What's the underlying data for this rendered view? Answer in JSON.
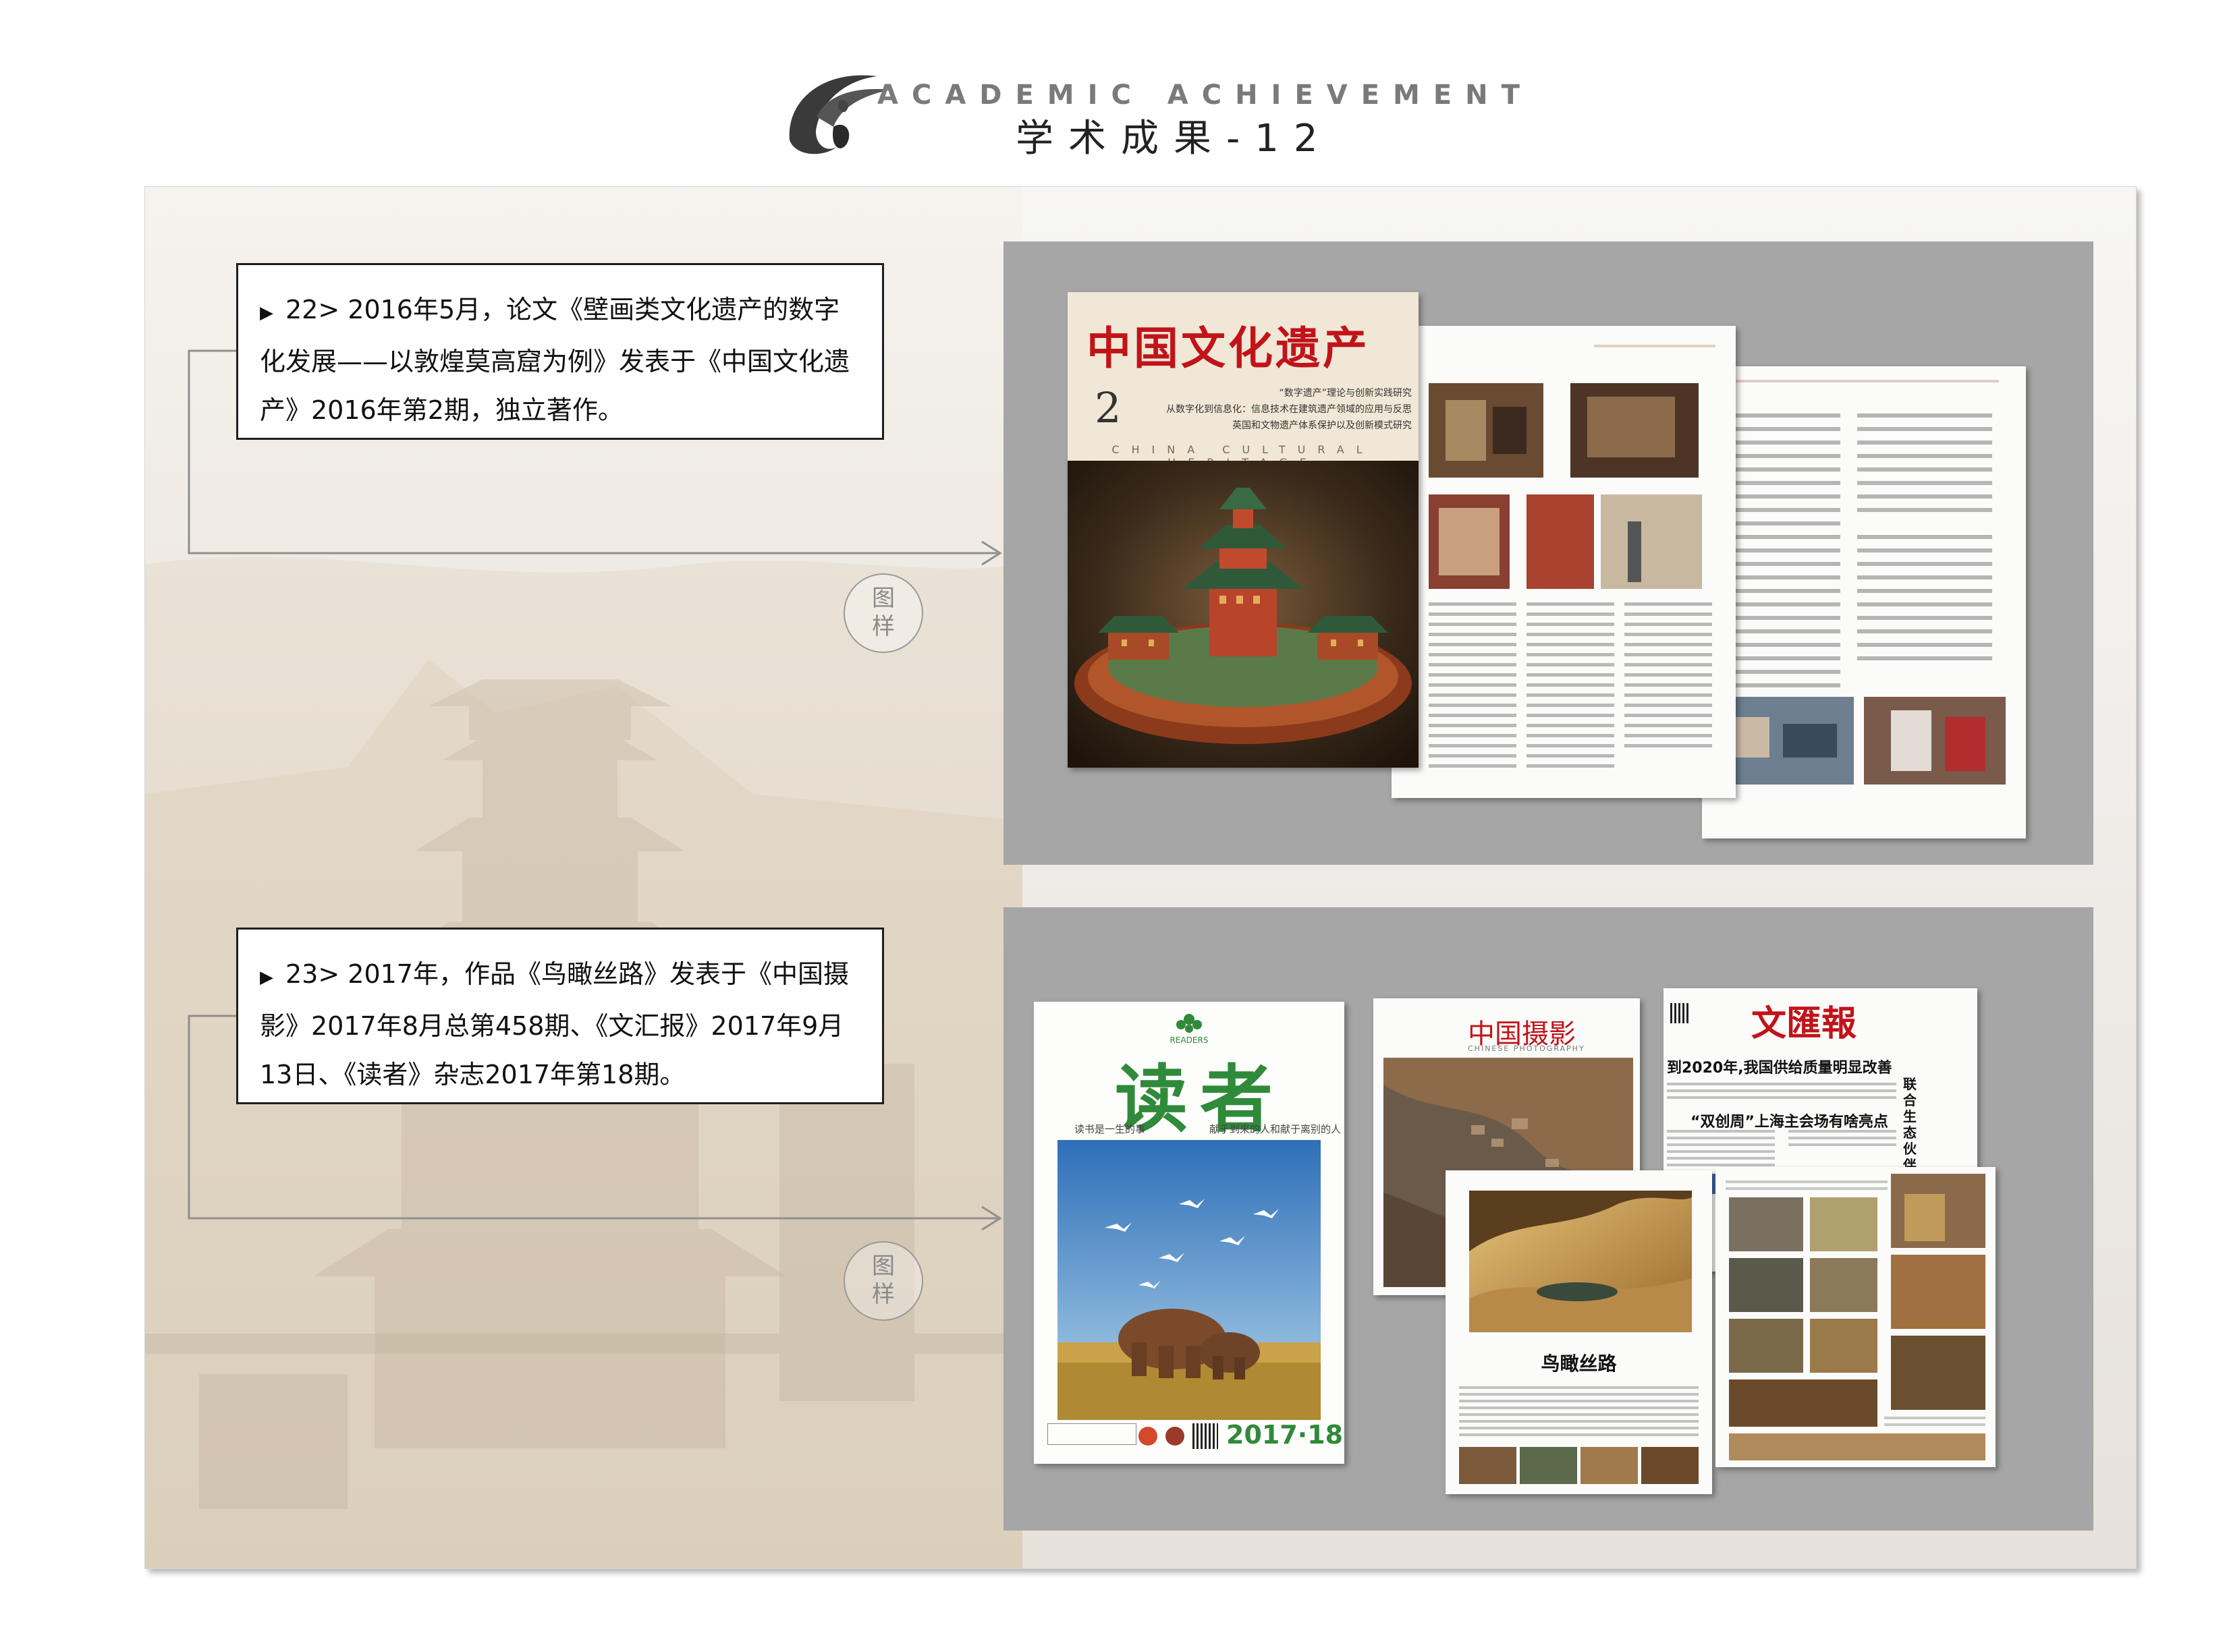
{
  "header": {
    "title_en": "ACADEMIC ACHIEVEMENT",
    "title_zh": "学术成果-12"
  },
  "entries": [
    {
      "text": "22> 2016年5月，论文《壁画类文化遗产的数字化发展——以敦煌莫高窟为例》发表于《中国文化遗产》2016年第2期，独立著作。",
      "sample_label_1": "图",
      "sample_label_2": "样"
    },
    {
      "text": "23> 2017年，作品《鸟瞰丝路》发表于《中国摄影》2017年8月总第458期、《文汇报》2017年9月13日、《读者》杂志2017年第18期。",
      "sample_label_1": "图",
      "sample_label_2": "样"
    }
  ],
  "magazine1": {
    "title": "中国文化遗产",
    "issue": "2",
    "subtitle_en": "CHINA CULTURAL HERITAGE",
    "cover_lines": [
      "“数字遗产”理论与创新实践研究",
      "从数字化到信息化：信息技术在建筑遗产领域的应用与反思",
      "英国和文物遗产体系保护以及创新模式研究"
    ]
  },
  "magazine2": {
    "readers_title": "读者",
    "readers_en": "READERS",
    "readers_issue": "2017·18",
    "readers_slogan_left": "读书是一生的事",
    "readers_slogan_right": "献于到来的人和献于离别的人",
    "photo_title": "中国摄影",
    "photo_en": "CHINESE PHOTOGRAPHY",
    "wenhui_title": "文匯報",
    "wenhui_headline": "到2020年,我国供给质量明显改善",
    "wenhui_sub": "“双创周”上海主会场有啥亮点",
    "wenhui_side": "联合生态伙伴令链路打",
    "article_title": "鸟瞰丝路"
  },
  "colors": {
    "magazine_red": "#c0141a",
    "readers_green": "#2f8a3a",
    "panel_gray": "#a6a6a6",
    "box_border": "#1e1e1e"
  },
  "icons": [
    "dunhuang-flying-apsara-logo",
    "arrow-right-icon",
    "triangle-bullet-icon"
  ]
}
